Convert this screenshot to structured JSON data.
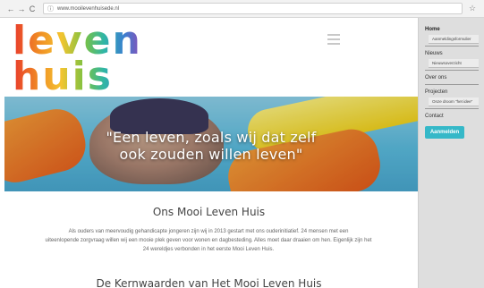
{
  "browser": {
    "back_icon": "←",
    "forward_icon": "→",
    "reload_icon": "C",
    "info_icon": "ⓘ",
    "url": "www.mooilevenhuisede.nl",
    "star_icon": "☆"
  },
  "logo": {
    "line1": "leven",
    "line2": "huis"
  },
  "hero": {
    "quote_line1": "\"Een leven, zoals wij dat zelf",
    "quote_line2": "ook zouden willen leven\""
  },
  "main": {
    "heading": "Ons Mooi Leven Huis",
    "intro_line1": "Als ouders van meervoudig gehandicapte jongeren zijn wij in 2013 gestart met ons ouderinitiatief. 24 mensen met een",
    "intro_line2": "uiteenlopende zorgvraag willen wij een mooie plek geven voor wonen en dagbesteding. Alles moet daar draaien om hen. Eigenlijk zijn het",
    "intro_line3": "24 wereldjes verbonden in het eerste Mooi Leven Huis.",
    "heading2": "De Kernwaarden van  Het Mooi Leven Huis"
  },
  "side_menu": {
    "home": "Home",
    "home_sub": "Aanmeldingsformulier",
    "nieuws": "Nieuws",
    "nieuws_sub": "Nieuwsoverzicht",
    "over_ons": "Over ons",
    "projecten": "Projecten",
    "projecten_sub": "Onze droom \"het idee\"",
    "contact": "Contact",
    "login_button": "Aanmelden"
  },
  "colors": {
    "accent": "#35b8c8",
    "side_bg": "#dedede"
  }
}
